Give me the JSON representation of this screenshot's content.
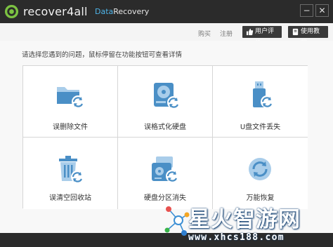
{
  "window": {
    "brand": "recover4all",
    "product_part1": "Data",
    "product_part2": "Recovery",
    "minimize": "−",
    "close": "✕",
    "logo_icon": "recover4all-logo-icon"
  },
  "topnav": {
    "buy": "购买",
    "register": "注册",
    "review": "用户评价",
    "guide": "使用教程",
    "review_icon": "thumbs-up-icon",
    "guide_icon": "book-icon"
  },
  "main": {
    "hint": "请选择您遇到的问题，鼠标停留在功能按钮可查看详情",
    "options": [
      {
        "label": "误删除文件",
        "icon": "folder-restore-icon"
      },
      {
        "label": "误格式化硬盘",
        "icon": "hard-disk-restore-icon"
      },
      {
        "label": "U盘文件丢失",
        "icon": "usb-drive-restore-icon"
      },
      {
        "label": "误清空回收站",
        "icon": "recycle-bin-restore-icon"
      },
      {
        "label": "硬盘分区消失",
        "icon": "partition-restore-icon"
      },
      {
        "label": "万能恢复",
        "icon": "universal-restore-icon"
      }
    ]
  },
  "watermark": {
    "title": "星火智游网",
    "url": "www.xhcs188.com"
  },
  "colors": {
    "titlebar": "#2b2b2b",
    "accent_blue": "#4fb4e8",
    "icon_blue": "#4a8fc6",
    "icon_light": "#a9cdea"
  }
}
